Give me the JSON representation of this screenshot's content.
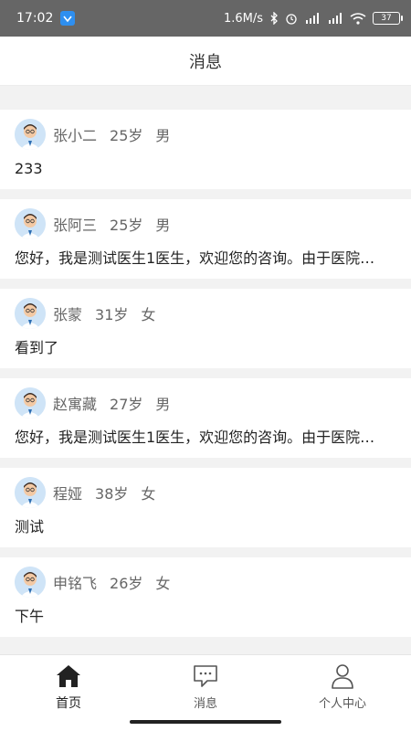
{
  "status_bar": {
    "time": "17:02",
    "speed": "1.6M/s",
    "battery": "37"
  },
  "header": {
    "title": "消息"
  },
  "messages": [
    {
      "name": "张小二",
      "age": "25岁",
      "gender": "男",
      "text": "233"
    },
    {
      "name": "张阿三",
      "age": "25岁",
      "gender": "男",
      "text": "您好，我是测试医生1医生，欢迎您的咨询。由于医院…"
    },
    {
      "name": "张蒙",
      "age": "31岁",
      "gender": "女",
      "text": "看到了"
    },
    {
      "name": "赵寓藏",
      "age": "27岁",
      "gender": "男",
      "text": "您好，我是测试医生1医生，欢迎您的咨询。由于医院…"
    },
    {
      "name": "程娅",
      "age": "38岁",
      "gender": "女",
      "text": "测试"
    },
    {
      "name": "申铭飞",
      "age": "26岁",
      "gender": "女",
      "text": "下午"
    }
  ],
  "tabs": [
    {
      "label": "首页",
      "icon": "home-icon",
      "active": true
    },
    {
      "label": "消息",
      "icon": "chat-icon",
      "active": false
    },
    {
      "label": "个人中心",
      "icon": "person-icon",
      "active": false
    }
  ],
  "colors": {
    "status_bar": "#666666",
    "page_background": "#f2f2f2",
    "card_background": "#ffffff"
  }
}
